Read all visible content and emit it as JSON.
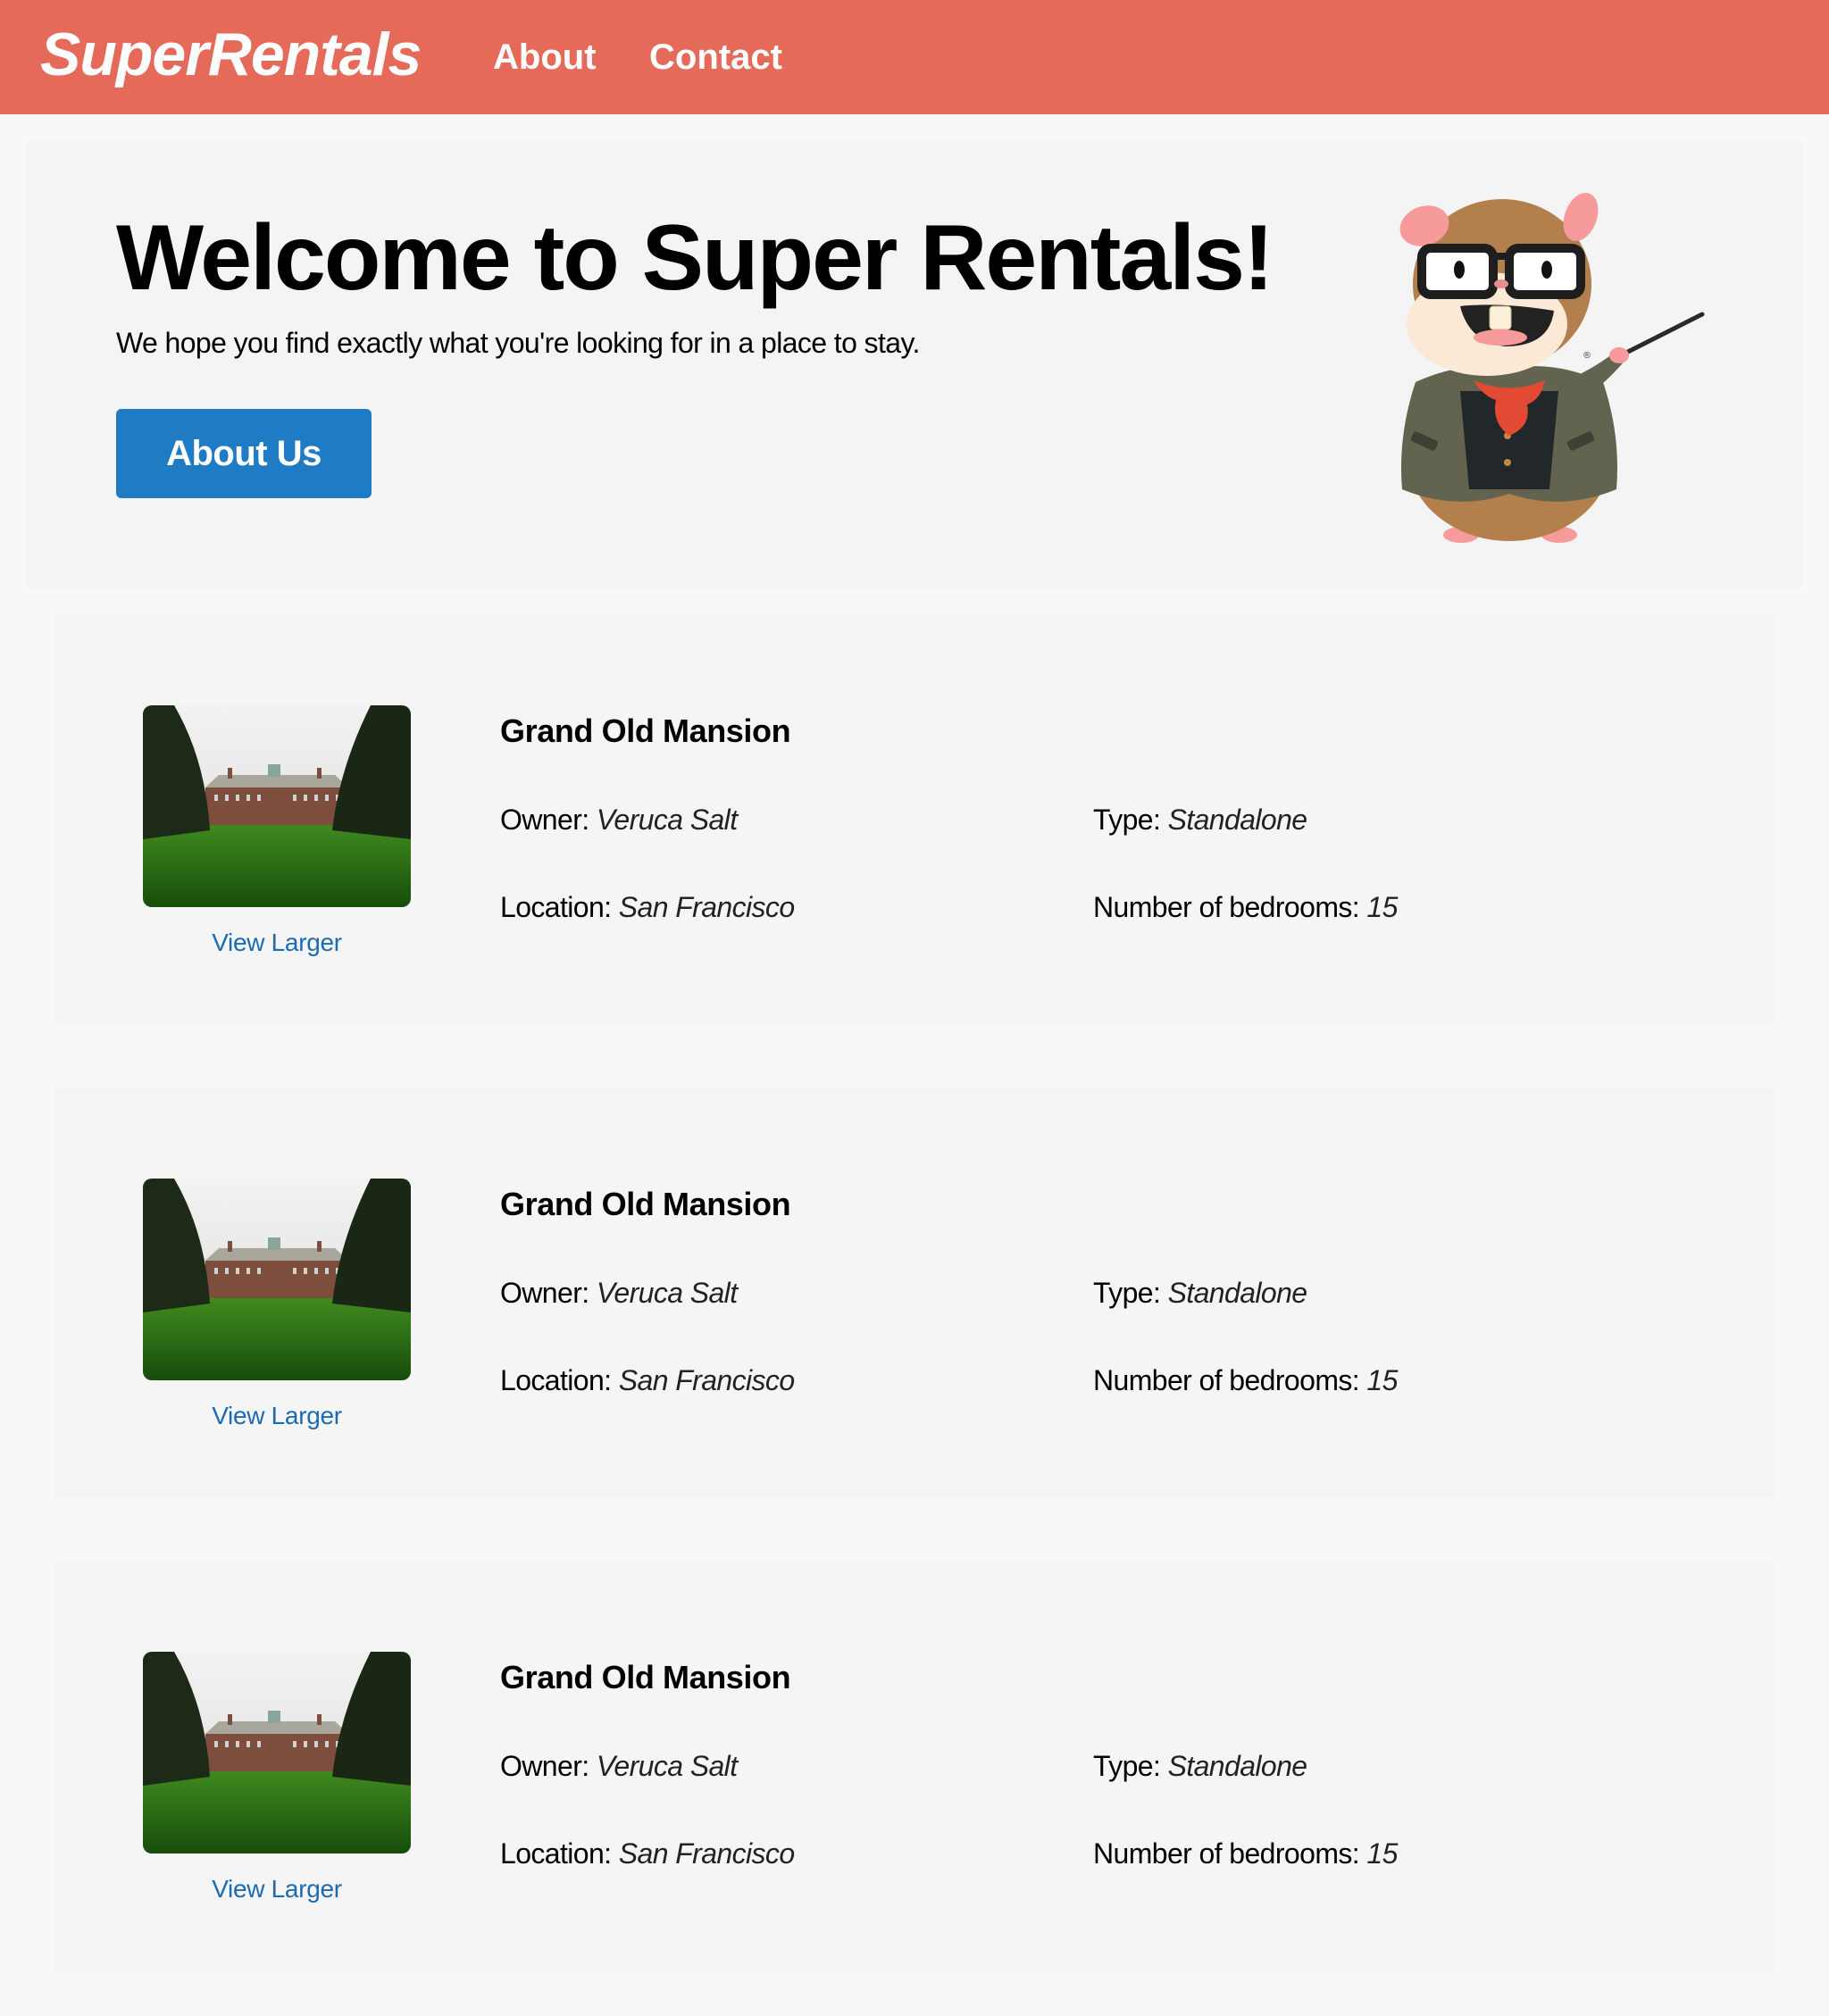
{
  "navbar": {
    "logo": "SuperRentals",
    "links": [
      "About",
      "Contact"
    ],
    "color": "#E56A59"
  },
  "jumbo": {
    "title": "Welcome to Super Rentals!",
    "subtitle": "We hope you find exactly what you're looking for in a place to stay.",
    "button_label": "About Us",
    "button_color": "#1E7BC4",
    "mascot": "tomster-hamster-professor"
  },
  "rentals": [
    {
      "title": "Grand Old Mansion",
      "owner_label": "Owner:",
      "owner": "Veruca Salt",
      "type_label": "Type:",
      "type": "Standalone",
      "location_label": "Location:",
      "location": "San Francisco",
      "bedrooms_label": "Number of bedrooms:",
      "bedrooms": "15",
      "image": "mansion-photo",
      "link_label": "View Larger"
    },
    {
      "title": "Grand Old Mansion",
      "owner_label": "Owner:",
      "owner": "Veruca Salt",
      "type_label": "Type:",
      "type": "Standalone",
      "location_label": "Location:",
      "location": "San Francisco",
      "bedrooms_label": "Number of bedrooms:",
      "bedrooms": "15",
      "image": "mansion-photo",
      "link_label": "View Larger"
    },
    {
      "title": "Grand Old Mansion",
      "owner_label": "Owner:",
      "owner": "Veruca Salt",
      "type_label": "Type:",
      "type": "Standalone",
      "location_label": "Location:",
      "location": "San Francisco",
      "bedrooms_label": "Number of bedrooms:",
      "bedrooms": "15",
      "image": "mansion-photo",
      "link_label": "View Larger"
    }
  ]
}
